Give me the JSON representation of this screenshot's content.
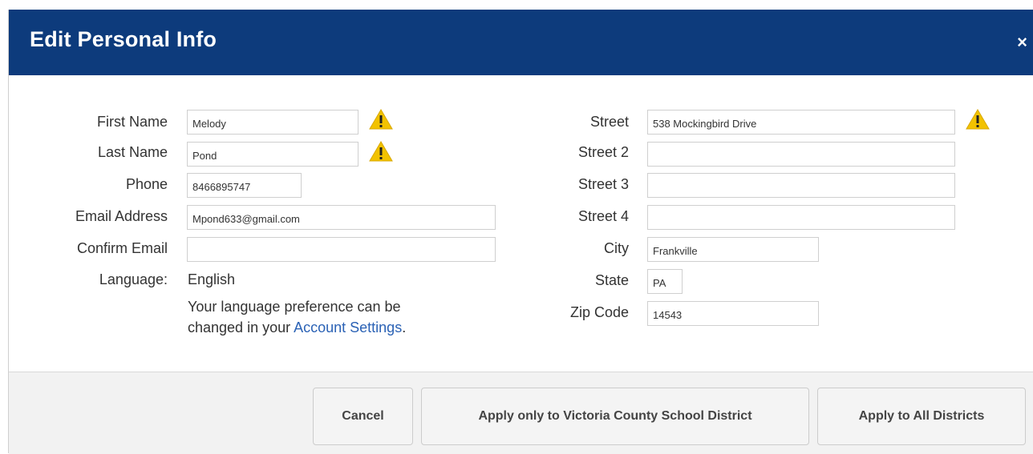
{
  "dialog": {
    "title": "Edit Personal Info",
    "close_label": "×"
  },
  "left_form": {
    "first_name": {
      "label": "First Name",
      "value": "Melody",
      "warning": true
    },
    "last_name": {
      "label": "Last Name",
      "value": "Pond",
      "warning": true
    },
    "phone": {
      "label": "Phone",
      "value": "8466895747"
    },
    "email": {
      "label": "Email Address",
      "value": "Mpond633@gmail.com"
    },
    "confirm_email": {
      "label": "Confirm Email",
      "value": ""
    },
    "language": {
      "label": "Language:",
      "value": "English",
      "note_line1": "Your language preference can be",
      "note_line2_prefix": "changed in your ",
      "note_link": "Account Settings",
      "note_suffix": "."
    }
  },
  "right_form": {
    "street": {
      "label": "Street",
      "value": "538 Mockingbird Drive",
      "warning": true
    },
    "street2": {
      "label": "Street 2",
      "value": ""
    },
    "street3": {
      "label": "Street 3",
      "value": ""
    },
    "street4": {
      "label": "Street 4",
      "value": ""
    },
    "city": {
      "label": "City",
      "value": "Frankville"
    },
    "state": {
      "label": "State",
      "value": "PA"
    },
    "zip": {
      "label": "Zip Code",
      "value": "14543"
    }
  },
  "footer": {
    "cancel_label": "Cancel",
    "apply_district_label": "Apply only to Victoria County School District",
    "apply_all_label": "Apply to All Districts"
  },
  "icons": {
    "warning": "warning-triangle-icon",
    "close": "close-icon"
  },
  "colors": {
    "header": "#0d3b7c",
    "warning": "#f2c200",
    "link": "#2b62b5"
  }
}
